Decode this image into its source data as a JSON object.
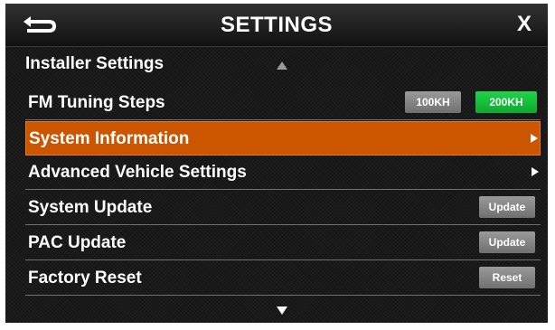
{
  "header": {
    "title": "SETTINGS",
    "close_label": "X",
    "back_icon": "back-arrow-icon"
  },
  "section": {
    "title": "Installer Settings"
  },
  "rows": [
    {
      "label": "FM Tuning Steps",
      "options": [
        "100KH",
        "200KH"
      ],
      "selected_option": "200KH"
    },
    {
      "label": "System Information",
      "selected": true
    },
    {
      "label": "Advanced Vehicle Settings"
    },
    {
      "label": "System Update",
      "button": "Update"
    },
    {
      "label": "PAC Update",
      "button": "Update"
    },
    {
      "label": "Factory Reset",
      "button": "Reset"
    }
  ],
  "colors": {
    "selected_row": "#cc5500",
    "active_option": "#14c03c",
    "button_gray": "#8a8a8a"
  }
}
